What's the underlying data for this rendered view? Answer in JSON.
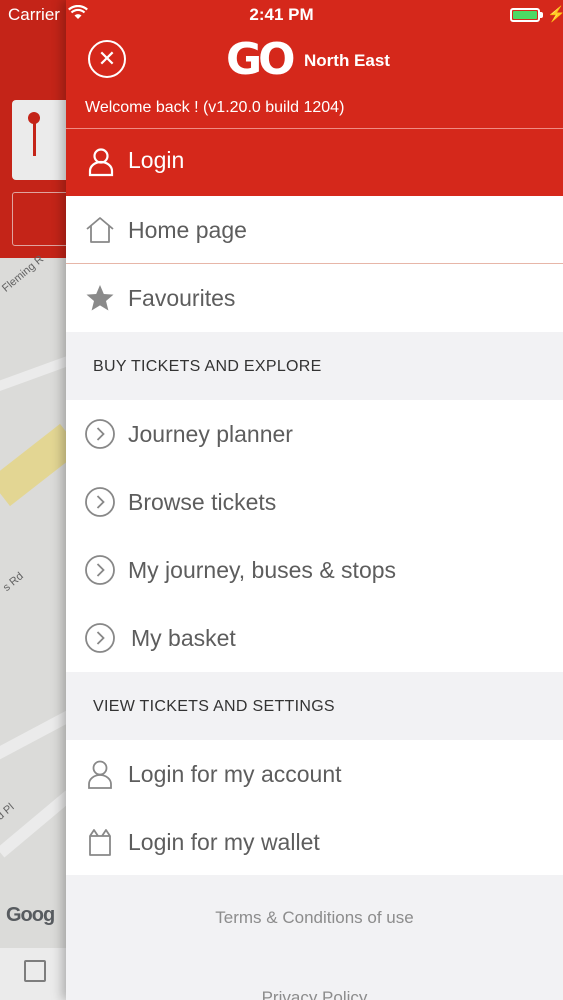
{
  "status_bar": {
    "carrier": "Carrier",
    "time": "2:41 PM",
    "battery_level": 1.0,
    "battery_color": "#4cd964"
  },
  "background_app": {
    "road_labels": [
      "Fleming R",
      "s Rd",
      "d Pl"
    ],
    "map_attribution": "Goog"
  },
  "drawer": {
    "brand_color": "#d5281b",
    "close_icon": "close-circle-icon",
    "logo": {
      "mark": "GO",
      "region": "North East"
    },
    "welcome": "Welcome back ! (v1.20.0 build 1204)",
    "login": {
      "label": "Login",
      "icon": "user-icon"
    },
    "items_top": [
      {
        "label": "Home page",
        "icon": "home-icon"
      },
      {
        "label": "Favourites",
        "icon": "star-icon"
      }
    ],
    "section_buy": "BUY TICKETS AND EXPLORE",
    "items_buy": [
      {
        "label": "Journey planner",
        "icon": "chevron-right-circle-icon"
      },
      {
        "label": "Browse tickets",
        "icon": "chevron-right-circle-icon"
      },
      {
        "label": "My journey, buses & stops",
        "icon": "chevron-right-circle-icon"
      },
      {
        "label": "My basket",
        "icon": "chevron-right-circle-icon"
      }
    ],
    "section_view": "VIEW TICKETS AND SETTINGS",
    "items_view": [
      {
        "label": "Login for my account",
        "icon": "user-icon"
      },
      {
        "label": "Login for my wallet",
        "icon": "wallet-icon"
      }
    ],
    "footer": {
      "terms": "Terms & Conditions of use",
      "privacy": "Privacy Policy"
    }
  }
}
